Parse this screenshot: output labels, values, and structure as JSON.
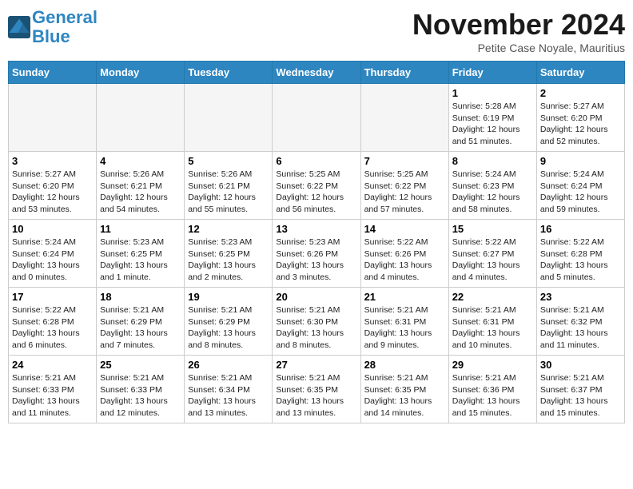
{
  "logo": {
    "line1": "General",
    "line2": "Blue"
  },
  "title": "November 2024",
  "location": "Petite Case Noyale, Mauritius",
  "weekdays": [
    "Sunday",
    "Monday",
    "Tuesday",
    "Wednesday",
    "Thursday",
    "Friday",
    "Saturday"
  ],
  "weeks": [
    [
      {
        "day": "",
        "info": ""
      },
      {
        "day": "",
        "info": ""
      },
      {
        "day": "",
        "info": ""
      },
      {
        "day": "",
        "info": ""
      },
      {
        "day": "",
        "info": ""
      },
      {
        "day": "1",
        "info": "Sunrise: 5:28 AM\nSunset: 6:19 PM\nDaylight: 12 hours\nand 51 minutes."
      },
      {
        "day": "2",
        "info": "Sunrise: 5:27 AM\nSunset: 6:20 PM\nDaylight: 12 hours\nand 52 minutes."
      }
    ],
    [
      {
        "day": "3",
        "info": "Sunrise: 5:27 AM\nSunset: 6:20 PM\nDaylight: 12 hours\nand 53 minutes."
      },
      {
        "day": "4",
        "info": "Sunrise: 5:26 AM\nSunset: 6:21 PM\nDaylight: 12 hours\nand 54 minutes."
      },
      {
        "day": "5",
        "info": "Sunrise: 5:26 AM\nSunset: 6:21 PM\nDaylight: 12 hours\nand 55 minutes."
      },
      {
        "day": "6",
        "info": "Sunrise: 5:25 AM\nSunset: 6:22 PM\nDaylight: 12 hours\nand 56 minutes."
      },
      {
        "day": "7",
        "info": "Sunrise: 5:25 AM\nSunset: 6:22 PM\nDaylight: 12 hours\nand 57 minutes."
      },
      {
        "day": "8",
        "info": "Sunrise: 5:24 AM\nSunset: 6:23 PM\nDaylight: 12 hours\nand 58 minutes."
      },
      {
        "day": "9",
        "info": "Sunrise: 5:24 AM\nSunset: 6:24 PM\nDaylight: 12 hours\nand 59 minutes."
      }
    ],
    [
      {
        "day": "10",
        "info": "Sunrise: 5:24 AM\nSunset: 6:24 PM\nDaylight: 13 hours\nand 0 minutes."
      },
      {
        "day": "11",
        "info": "Sunrise: 5:23 AM\nSunset: 6:25 PM\nDaylight: 13 hours\nand 1 minute."
      },
      {
        "day": "12",
        "info": "Sunrise: 5:23 AM\nSunset: 6:25 PM\nDaylight: 13 hours\nand 2 minutes."
      },
      {
        "day": "13",
        "info": "Sunrise: 5:23 AM\nSunset: 6:26 PM\nDaylight: 13 hours\nand 3 minutes."
      },
      {
        "day": "14",
        "info": "Sunrise: 5:22 AM\nSunset: 6:26 PM\nDaylight: 13 hours\nand 4 minutes."
      },
      {
        "day": "15",
        "info": "Sunrise: 5:22 AM\nSunset: 6:27 PM\nDaylight: 13 hours\nand 4 minutes."
      },
      {
        "day": "16",
        "info": "Sunrise: 5:22 AM\nSunset: 6:28 PM\nDaylight: 13 hours\nand 5 minutes."
      }
    ],
    [
      {
        "day": "17",
        "info": "Sunrise: 5:22 AM\nSunset: 6:28 PM\nDaylight: 13 hours\nand 6 minutes."
      },
      {
        "day": "18",
        "info": "Sunrise: 5:21 AM\nSunset: 6:29 PM\nDaylight: 13 hours\nand 7 minutes."
      },
      {
        "day": "19",
        "info": "Sunrise: 5:21 AM\nSunset: 6:29 PM\nDaylight: 13 hours\nand 8 minutes."
      },
      {
        "day": "20",
        "info": "Sunrise: 5:21 AM\nSunset: 6:30 PM\nDaylight: 13 hours\nand 8 minutes."
      },
      {
        "day": "21",
        "info": "Sunrise: 5:21 AM\nSunset: 6:31 PM\nDaylight: 13 hours\nand 9 minutes."
      },
      {
        "day": "22",
        "info": "Sunrise: 5:21 AM\nSunset: 6:31 PM\nDaylight: 13 hours\nand 10 minutes."
      },
      {
        "day": "23",
        "info": "Sunrise: 5:21 AM\nSunset: 6:32 PM\nDaylight: 13 hours\nand 11 minutes."
      }
    ],
    [
      {
        "day": "24",
        "info": "Sunrise: 5:21 AM\nSunset: 6:33 PM\nDaylight: 13 hours\nand 11 minutes."
      },
      {
        "day": "25",
        "info": "Sunrise: 5:21 AM\nSunset: 6:33 PM\nDaylight: 13 hours\nand 12 minutes."
      },
      {
        "day": "26",
        "info": "Sunrise: 5:21 AM\nSunset: 6:34 PM\nDaylight: 13 hours\nand 13 minutes."
      },
      {
        "day": "27",
        "info": "Sunrise: 5:21 AM\nSunset: 6:35 PM\nDaylight: 13 hours\nand 13 minutes."
      },
      {
        "day": "28",
        "info": "Sunrise: 5:21 AM\nSunset: 6:35 PM\nDaylight: 13 hours\nand 14 minutes."
      },
      {
        "day": "29",
        "info": "Sunrise: 5:21 AM\nSunset: 6:36 PM\nDaylight: 13 hours\nand 15 minutes."
      },
      {
        "day": "30",
        "info": "Sunrise: 5:21 AM\nSunset: 6:37 PM\nDaylight: 13 hours\nand 15 minutes."
      }
    ]
  ]
}
